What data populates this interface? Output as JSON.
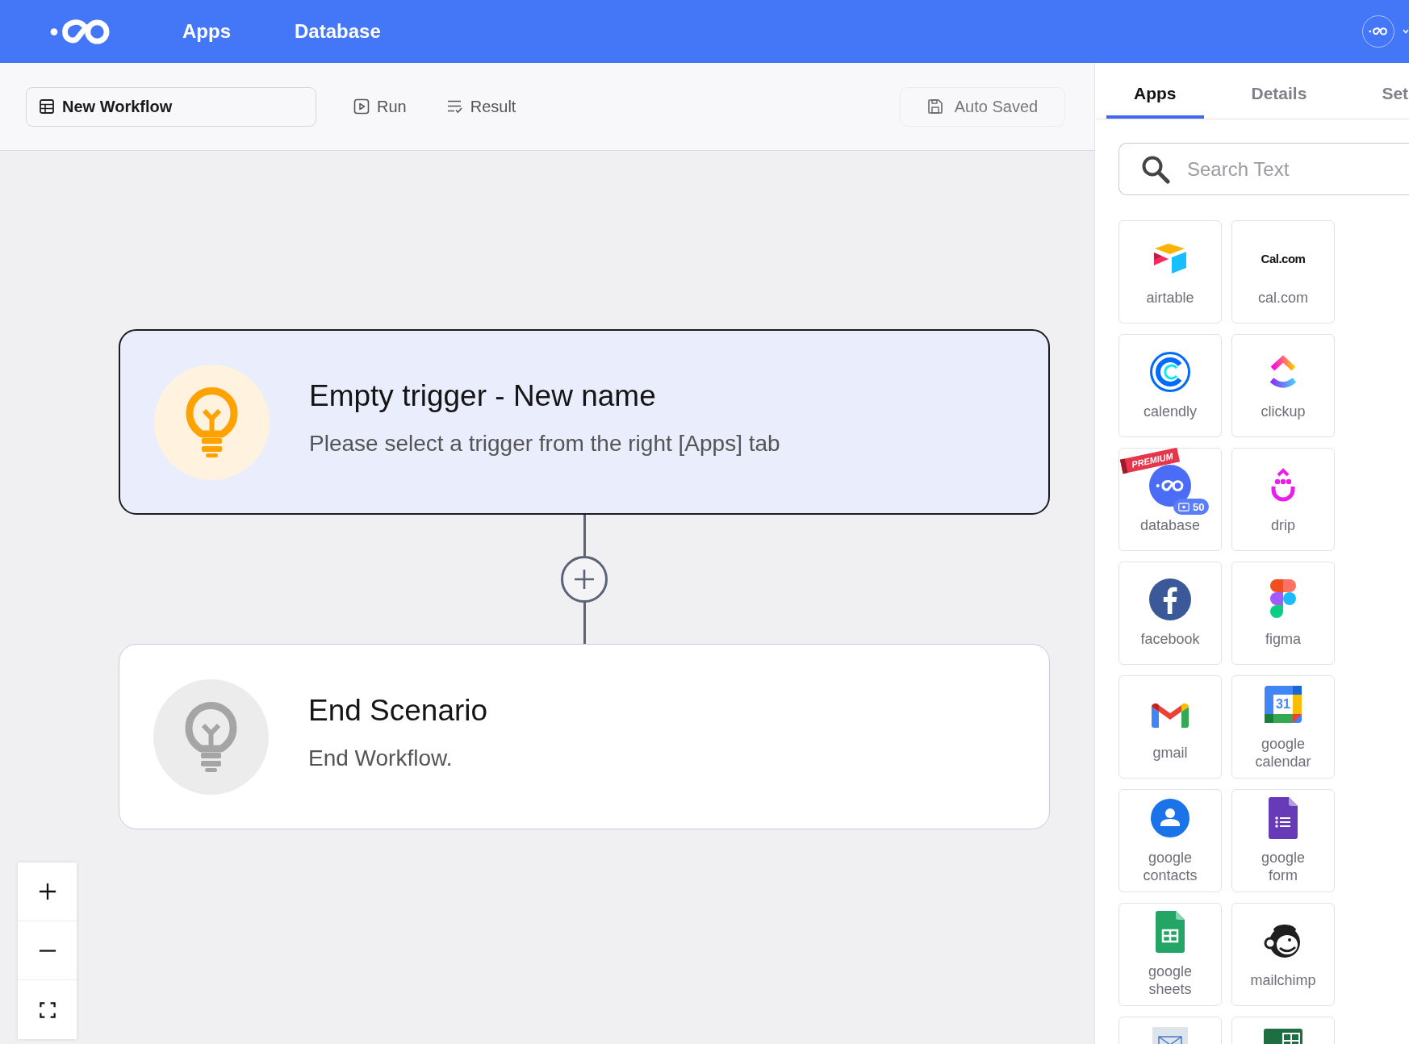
{
  "header": {
    "nav": [
      "Apps",
      "Database"
    ]
  },
  "toolbar": {
    "workflow_name": "New Workflow",
    "actions": [
      {
        "kind": "run",
        "label": "Run"
      },
      {
        "kind": "result",
        "label": "Result"
      }
    ],
    "save_status": "Auto Saved"
  },
  "canvas": {
    "nodes": [
      {
        "kind": "trigger",
        "selected": true,
        "title": "Empty trigger - New name",
        "description": "Please select a trigger from the right [Apps] tab"
      },
      {
        "kind": "end",
        "selected": false,
        "title": "End Scenario",
        "description": "End Workflow."
      }
    ]
  },
  "panel": {
    "tabs": [
      {
        "label": "Apps",
        "selected": true
      },
      {
        "label": "Details",
        "selected": false
      },
      {
        "label": "Set",
        "selected": false
      }
    ],
    "search": {
      "placeholder": "Search Text"
    },
    "app_rows": [
      [
        {
          "kind": "airtable",
          "label": "airtable"
        },
        {
          "kind": "calcom",
          "label": "cal.com",
          "logo_text": "Cal.com"
        }
      ],
      [
        {
          "kind": "calendly",
          "label": "calendly"
        },
        {
          "kind": "clickup",
          "label": "clickup"
        }
      ],
      [
        {
          "kind": "database",
          "label": "database",
          "ribbon": "PREMIUM",
          "badge": "50"
        },
        {
          "kind": "drip",
          "label": "drip"
        }
      ],
      [
        {
          "kind": "facebook",
          "label": "facebook"
        },
        {
          "kind": "figma",
          "label": "figma"
        }
      ],
      [
        {
          "kind": "gmail",
          "label": "gmail"
        },
        {
          "kind": "gcalendar",
          "label": "google calendar",
          "logo_text": "31"
        }
      ],
      [
        {
          "kind": "gcontacts",
          "label": "google contacts"
        },
        {
          "kind": "gforms",
          "label": "google form"
        }
      ],
      [
        {
          "kind": "gsheets",
          "label": "google sheets"
        },
        {
          "kind": "mailchimp",
          "label": "mailchimp"
        }
      ],
      [
        {
          "kind": "mailpara"
        },
        {
          "kind": "excel"
        }
      ]
    ]
  }
}
